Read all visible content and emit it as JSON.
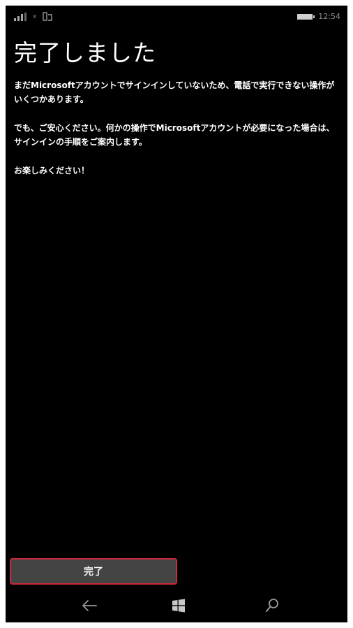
{
  "status_bar": {
    "signal_label": "x",
    "time": "12:54"
  },
  "screen": {
    "title": "完了しました",
    "paragraphs": [
      "まだMicrosoftアカウントでサインインしていないため、電話で実行できない操作がいくつかあります。",
      "でも、ご安心ください。何かの操作でMicrosoftアカウントが必要になった場合は、サインインの手順をご案内します。",
      "お楽しみください！"
    ]
  },
  "done_button": {
    "label": "完了"
  },
  "nav_bar": {
    "back_icon": "back-arrow-icon",
    "home_icon": "windows-logo-icon",
    "search_icon": "search-icon"
  },
  "colors": {
    "background": "#000000",
    "button_border": "#d0283a",
    "button_fill": "#444444"
  }
}
